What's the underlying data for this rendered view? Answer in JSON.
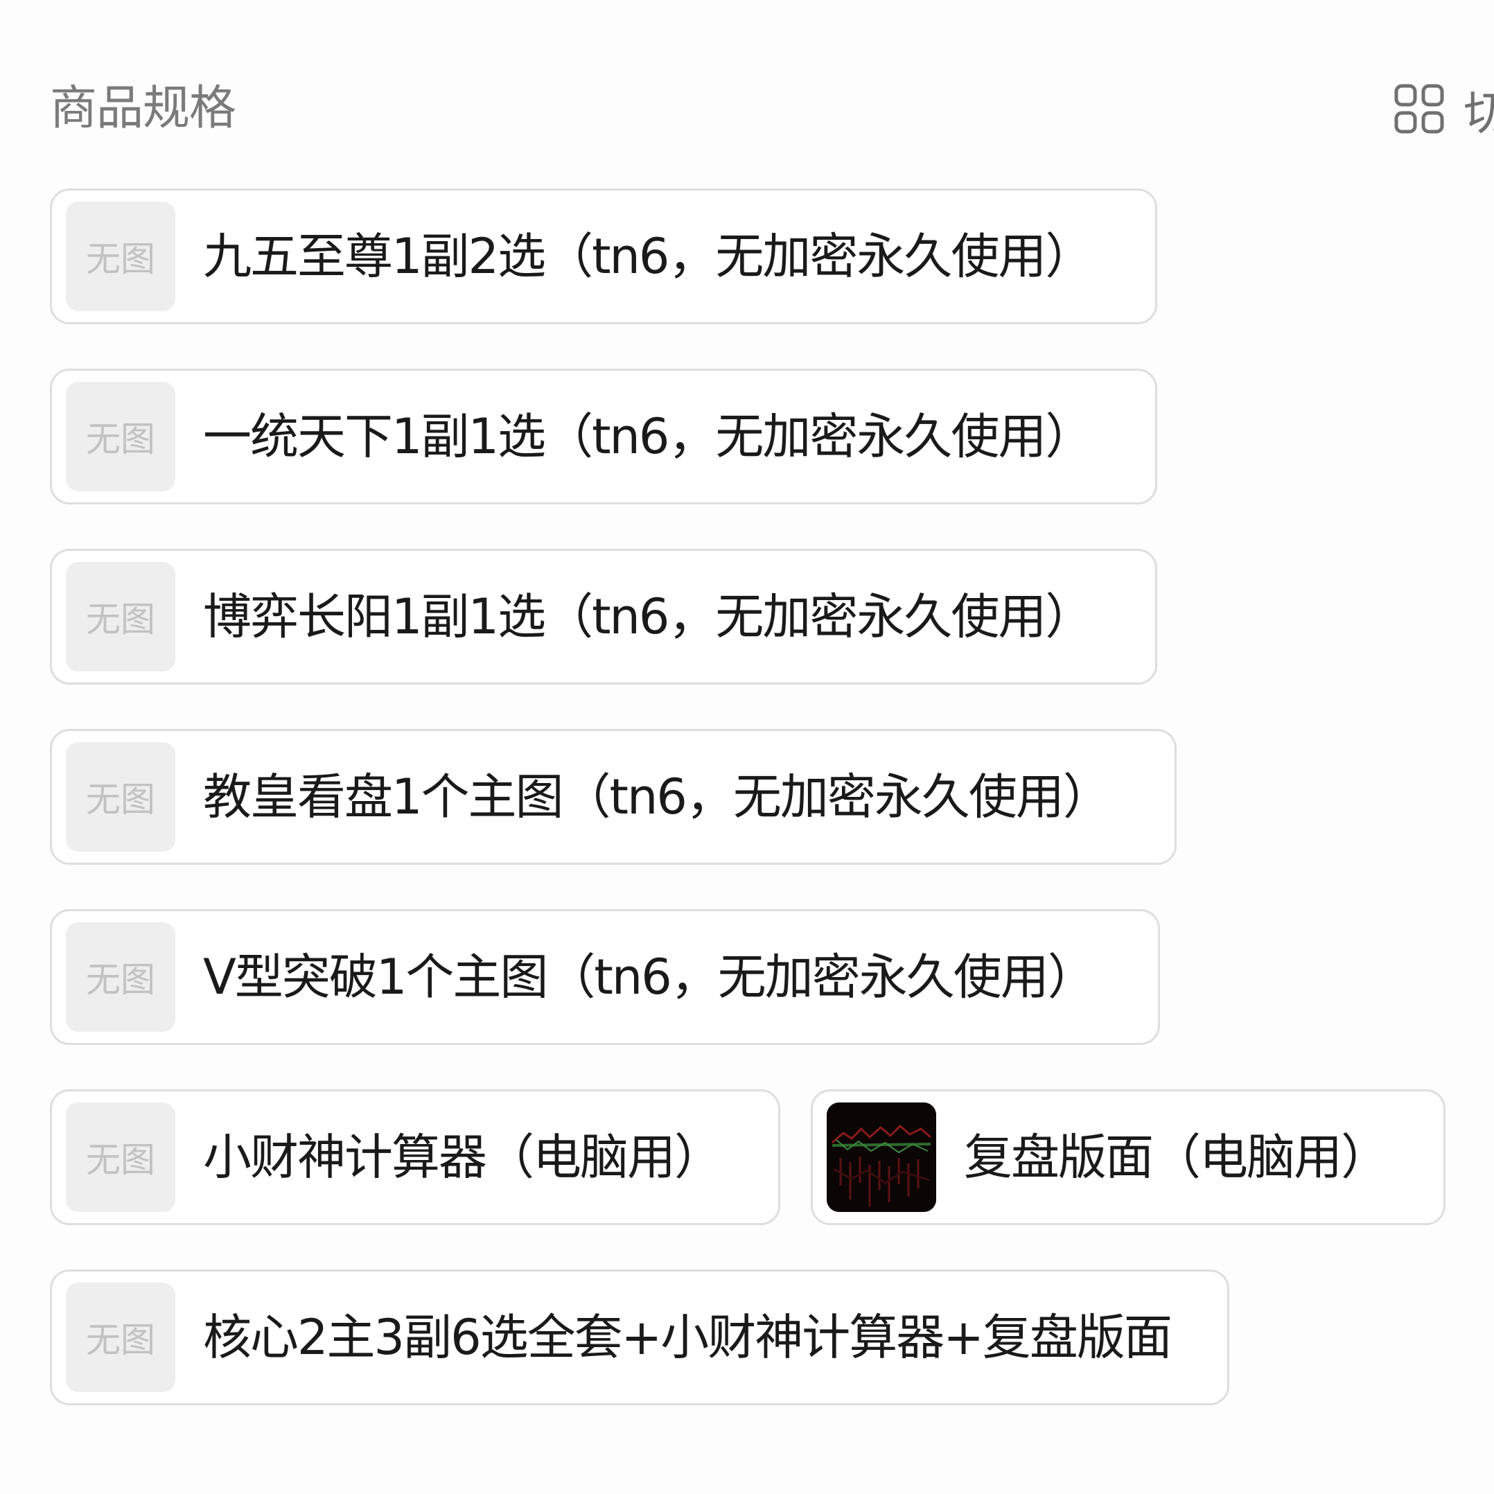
{
  "header": {
    "title": "商品规格",
    "toggle_label": "切"
  },
  "specs": [
    {
      "label": "九五至尊1副2选（tn6，无加密永久使用）",
      "thumb": "无图"
    },
    {
      "label": "一统天下1副1选（tn6，无加密永久使用）",
      "thumb": "无图"
    },
    {
      "label": "博弈长阳1副1选（tn6，无加密永久使用）",
      "thumb": "无图"
    },
    {
      "label": "教皇看盘1个主图（tn6，无加密永久使用）",
      "thumb": "无图"
    },
    {
      "label": "V型突破1个主图（tn6，无加密永久使用）",
      "thumb": "无图"
    },
    {
      "label": "小财神计算器（电脑用）",
      "thumb": "无图"
    },
    {
      "label": "复盘版面（电脑用）",
      "thumb_icon": "chart-thumbnail-image"
    },
    {
      "label": "核心2主3副6选全套+小财神计算器+复盘版面",
      "thumb": "无图"
    }
  ],
  "colors": {
    "background": "#fdfdfd",
    "card_border": "#dedede",
    "placeholder_bg": "#eeeeee",
    "placeholder_text": "#c2c2c2",
    "text": "#1a1a1a",
    "muted": "#7b7b7b"
  },
  "icons": {
    "view_toggle": "grid-view-icon"
  }
}
